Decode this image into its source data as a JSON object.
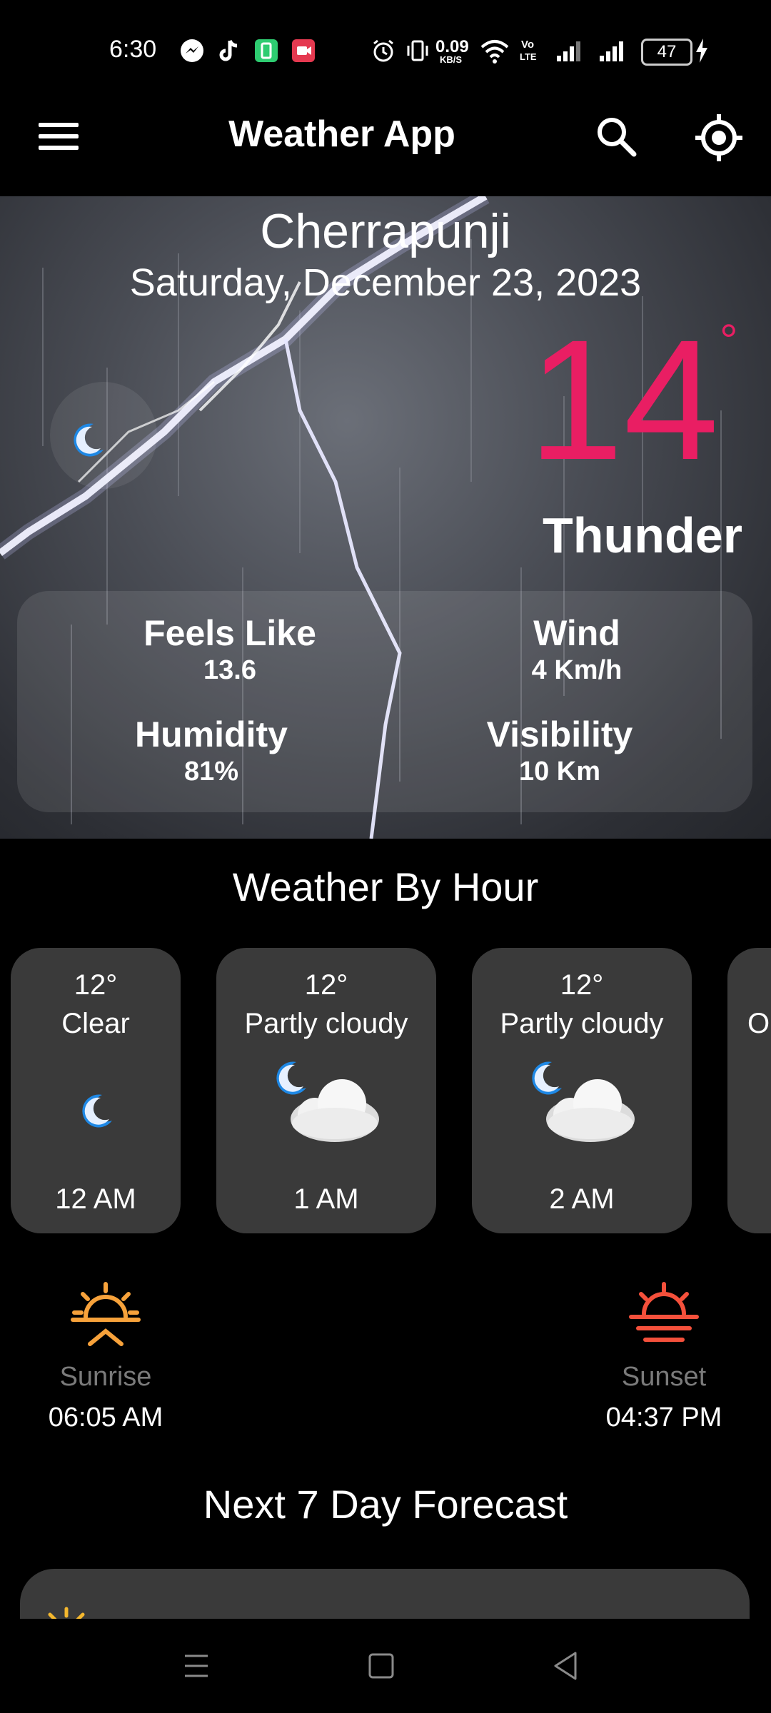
{
  "status_bar": {
    "time": "6:30",
    "net_speed_value": "0.09",
    "net_speed_unit": "KB/S",
    "volte_top": "Vo",
    "volte_bottom": "LTE",
    "battery": "47"
  },
  "app_bar": {
    "title": "Weather App",
    "menu_icon": "hamburger-menu-icon",
    "search_icon": "search-icon",
    "location_icon": "my-location-icon"
  },
  "current": {
    "city": "Cherrapunji",
    "date": "Saturday, December 23, 2023",
    "temperature": "14",
    "degree_symbol": "°",
    "condition": "Thunder",
    "icon": "crescent-moon-icon",
    "feels_like_label": "Feels Like",
    "feels_like_value": "13.6",
    "wind_label": "Wind",
    "wind_value": "4 Km/h",
    "humidity_label": "Humidity",
    "humidity_value": "81%",
    "visibility_label": "Visibility",
    "visibility_value": "10 Km"
  },
  "hourly": {
    "title": "Weather By Hour",
    "items": [
      {
        "temp": "12°",
        "condition": "Clear",
        "time": "12 AM",
        "icon": "crescent-moon-icon"
      },
      {
        "temp": "12°",
        "condition": "Partly cloudy",
        "time": "1 AM",
        "icon": "moon-cloud-icon"
      },
      {
        "temp": "12°",
        "condition": "Partly cloudy",
        "time": "2 AM",
        "icon": "moon-cloud-icon"
      },
      {
        "temp": "",
        "condition": "O",
        "time": "",
        "icon": "moon-cloud-icon"
      }
    ]
  },
  "sun": {
    "sunrise_label": "Sunrise",
    "sunrise_time": "06:05 AM",
    "sunset_label": "Sunset",
    "sunset_time": "04:37 PM",
    "sunrise_icon": "sunrise-icon",
    "sunset_icon": "sunset-icon"
  },
  "forecast": {
    "title": "Next 7 Day Forecast",
    "first_icon": "sun-icon"
  },
  "nav_bar": {
    "recents_icon": "recents-icon",
    "home_icon": "home-icon",
    "back_icon": "back-icon"
  },
  "colors": {
    "temperature": "#e91e63",
    "card_bg": "#3a3a3a",
    "sunrise": "#f7a23b",
    "sunset": "#f4503b"
  }
}
